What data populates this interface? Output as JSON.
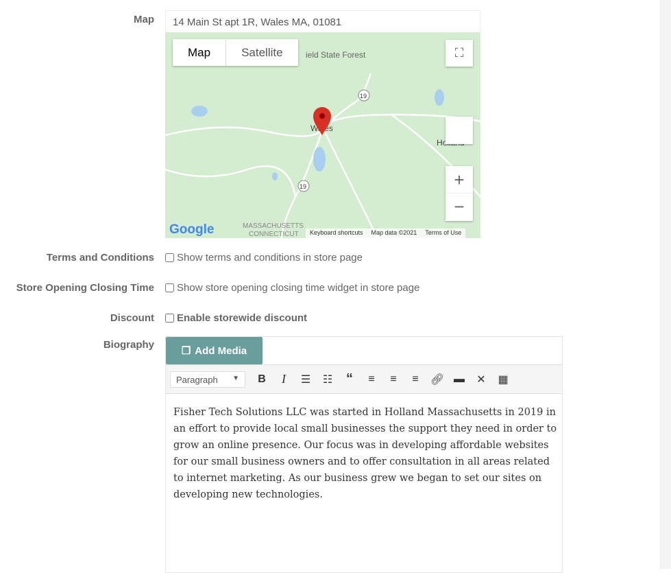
{
  "labels": {
    "map": "Map",
    "terms": "Terms and Conditions",
    "opening": "Store Opening Closing Time",
    "discount": "Discount",
    "bio": "Biography"
  },
  "map": {
    "address": "14 Main St apt 1R, Wales MA, 01081",
    "tab_map": "Map",
    "tab_satellite": "Satellite",
    "place_wales": "Wales",
    "place_holland": "Holland",
    "place_forest": "ield State Forest",
    "route": "19",
    "state1": "MASSACHUSETTS",
    "state2": "CONNECTICUT",
    "logo": "Google",
    "keyboard": "Keyboard shortcuts",
    "mapdata": "Map data ©2021",
    "terms": "Terms of Use",
    "zoom_in": "+",
    "zoom_out": "−"
  },
  "checks": {
    "terms": "Show terms and conditions in store page",
    "opening": "Show store opening closing time widget in store page",
    "discount": "Enable storewide discount"
  },
  "editor": {
    "add_media": "Add Media",
    "format": "Paragraph",
    "toolbar": [
      "bold-icon",
      "italic-icon",
      "bullet-list-icon",
      "numbered-list-icon",
      "blockquote-icon",
      "align-left-icon",
      "align-center-icon",
      "align-right-icon",
      "link-icon",
      "read-more-icon",
      "fullscreen-icon",
      "toolbar-toggle-icon"
    ],
    "content": "Fisher Tech Solutions LLC was started in Holland Massachusetts in 2019 in an effort to provide local small businesses the support they need in order to grow an online presence. Our focus was in developing affordable websites for our small business owners and to offer consultation in all areas related to internet marketing. As our business grew we began to set our sites on developing new technologies."
  },
  "colors": {
    "accent": "#6a9e9c",
    "pin": "#d93025"
  }
}
